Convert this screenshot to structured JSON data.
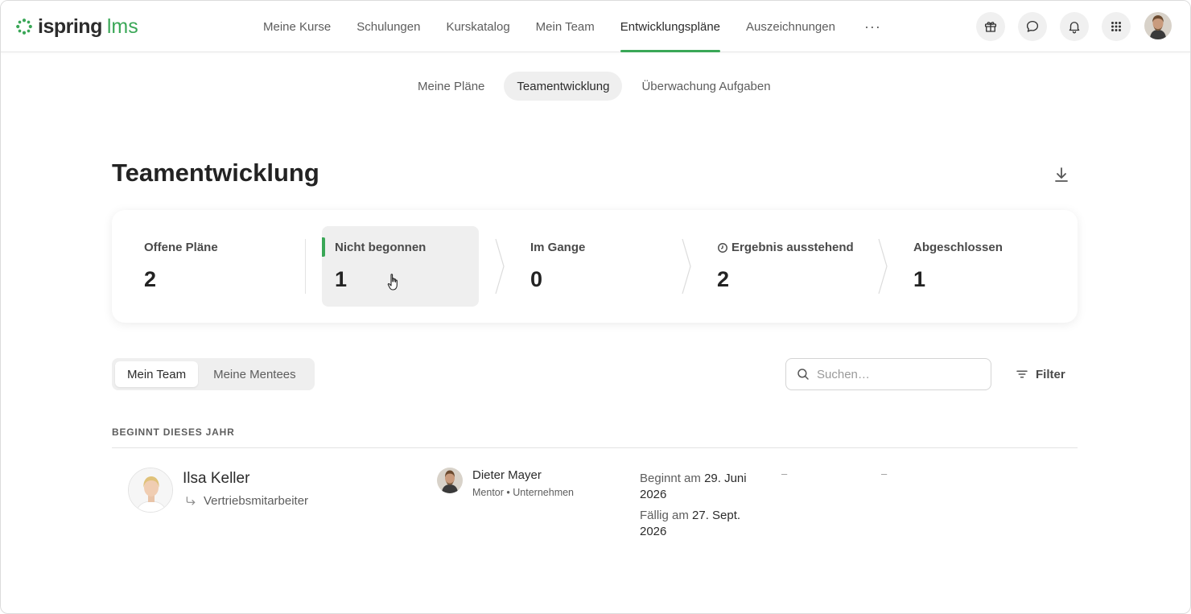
{
  "colors": {
    "accent": "#3aa757",
    "text": "#2b2b2b",
    "muted": "#5d5d5d"
  },
  "logo": {
    "brand": "ispring",
    "product": "lms"
  },
  "nav": {
    "items": [
      "Meine Kurse",
      "Schulungen",
      "Kurskatalog",
      "Mein Team",
      "Entwicklungspläne",
      "Auszeichnungen"
    ],
    "more": "···",
    "active": "Entwicklungspläne"
  },
  "header_icons": [
    "gift-icon",
    "chat-icon",
    "bell-icon",
    "apps-grid-icon"
  ],
  "subtabs": {
    "items": [
      "Meine Pläne",
      "Teamentwicklung",
      "Überwachung Aufgaben"
    ],
    "active": "Teamentwicklung"
  },
  "page": {
    "title": "Teamentwicklung"
  },
  "stats": [
    {
      "label": "Offene Pläne",
      "value": "2"
    },
    {
      "label": "Nicht begonnen",
      "value": "1",
      "active": true
    },
    {
      "label": "Im Gange",
      "value": "0"
    },
    {
      "label": "Ergebnis ausstehend",
      "value": "2",
      "icon": "clock-icon"
    },
    {
      "label": "Abgeschlossen",
      "value": "1"
    }
  ],
  "segment": {
    "items": [
      "Mein Team",
      "Meine Mentees"
    ],
    "active": "Mein Team"
  },
  "search": {
    "placeholder": "Suchen…",
    "value": ""
  },
  "filter": {
    "label": "Filter"
  },
  "section": {
    "title": "BEGINNT DIESES JAHR"
  },
  "rows": [
    {
      "name": "Ilsa Keller",
      "role": "Vertriebsmitarbeiter",
      "mentor": {
        "name": "Dieter Mayer",
        "role": "Mentor",
        "scope": "Unternehmen",
        "separator": "•"
      },
      "start_label": "Beginnt am",
      "start_date": "29. Juni 2026",
      "due_label": "Fällig am",
      "due_date": "27. Sept. 2026",
      "col4": "–",
      "col5": "–"
    }
  ]
}
